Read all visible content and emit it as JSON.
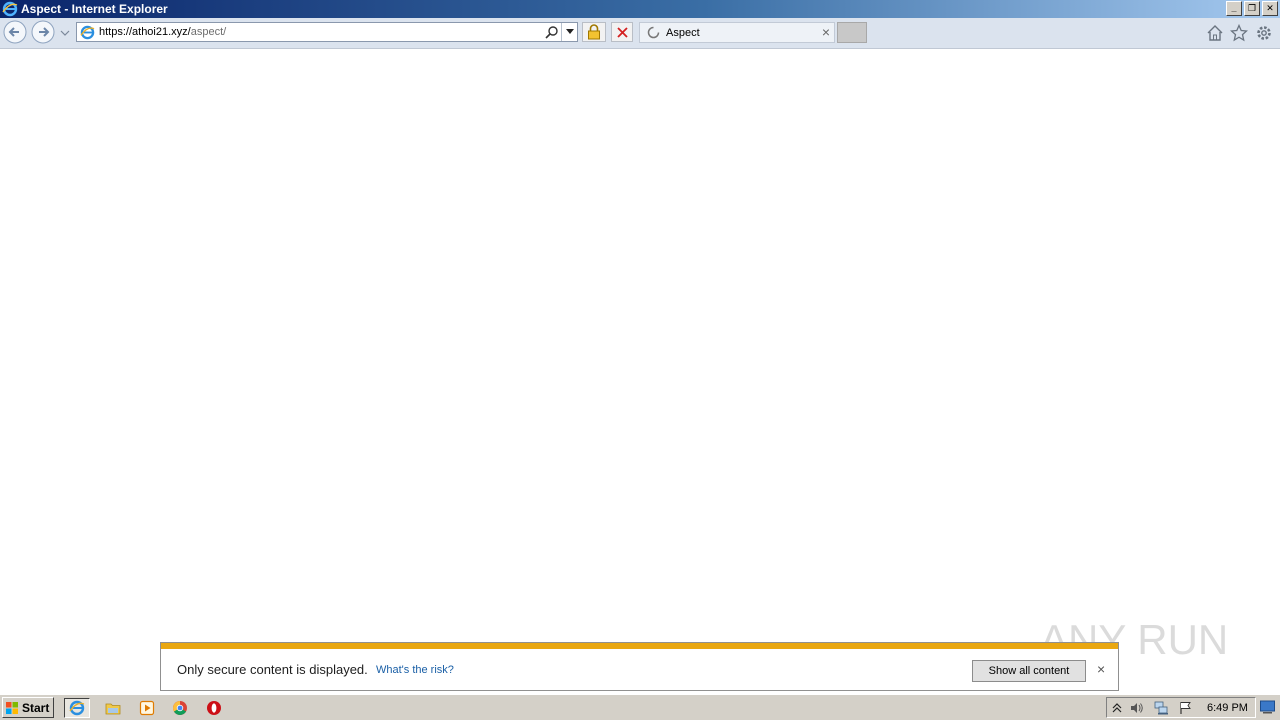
{
  "window": {
    "title": "Aspect - Internet Explorer",
    "controls": {
      "minimize": "_",
      "restore": "❐",
      "close": "✕"
    }
  },
  "toolbar": {
    "address": {
      "url_host": "https://athoi21.xyz/",
      "url_path": "aspect/"
    },
    "tab": {
      "label": "Aspect",
      "close": "×"
    }
  },
  "notification": {
    "message": "Only secure content is displayed.",
    "risk_link": "What's the risk?",
    "show_button": "Show all content",
    "close": "×"
  },
  "watermark": "ANY RUN",
  "taskbar": {
    "start_label": "Start",
    "clock": "6:49 PM"
  },
  "colors": {
    "notification_accent": "#e9a711",
    "link": "#1a5fa6",
    "titlebar_start": "#0a246a",
    "titlebar_end": "#a6caf0"
  },
  "icons": [
    "ie-icon",
    "back-icon",
    "forward-icon",
    "search-icon",
    "lock-icon",
    "stop-icon",
    "loading-spinner-icon",
    "home-icon",
    "favorites-star-icon",
    "gear-icon",
    "windows-logo-icon",
    "folder-icon",
    "media-player-icon",
    "chrome-icon",
    "opera-icon",
    "tray-arrow-icon",
    "speaker-icon",
    "network-icon",
    "flag-icon",
    "show-desktop-icon"
  ]
}
